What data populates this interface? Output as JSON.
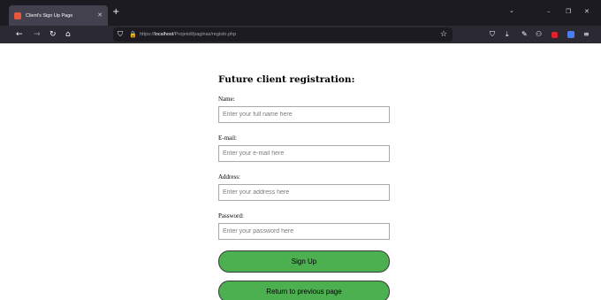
{
  "browser": {
    "tab_title": "Client's Sign Up Page",
    "tab_close": "✕",
    "new_tab": "+",
    "url_prefix": "https://",
    "url_host": "localhost",
    "url_path": "/Projetoll/paginas/registo.php",
    "window_controls": {
      "list": "⌄",
      "minimize": "–",
      "restore": "❐",
      "close": "✕"
    },
    "nav_icons": {
      "back": "←",
      "forward": "→",
      "reload": "↻",
      "home": "⌂"
    },
    "url_icons": {
      "shield": "⛉",
      "lock": "🔒",
      "star": "☆"
    },
    "toolbar_icons": {
      "pocket": "⛉",
      "download": "⤓",
      "wrench": "✎",
      "mask": "⚇",
      "menu": "≡"
    },
    "colors": {
      "tabstrip": "#1c1b22",
      "navbar": "#2b2a33",
      "favicon": "#e8563c",
      "extension_red": "#e0202a",
      "extension_blue": "#4a7ff0"
    }
  },
  "form": {
    "title": "Future client registration:",
    "fields": [
      {
        "label": "Name:",
        "placeholder": "Enter your full name here",
        "value": ""
      },
      {
        "label": "E-mail:",
        "placeholder": "Enter your e-mail here",
        "value": ""
      },
      {
        "label": "Address:",
        "placeholder": "Enter your address here",
        "value": ""
      },
      {
        "label": "Password:",
        "placeholder": "Enter your password here",
        "value": ""
      }
    ],
    "signup_label": "Sign Up",
    "return_label": "Return to previous page",
    "button_color": "#4caf50"
  }
}
